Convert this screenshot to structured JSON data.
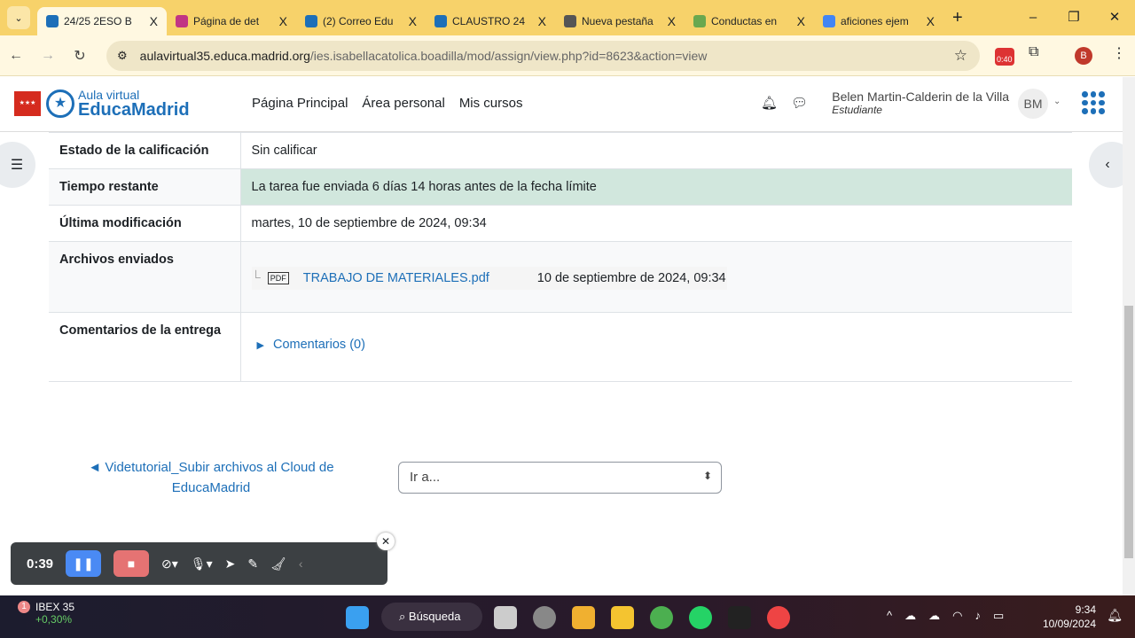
{
  "browser": {
    "tabs": [
      {
        "title": "24/25 2ESO B",
        "color": "#1d6fb8"
      },
      {
        "title": "Página de det",
        "color": "#c13584"
      },
      {
        "title": "(2) Correo Edu",
        "color": "#1d6fb8"
      },
      {
        "title": "CLAUSTRO 24",
        "color": "#1d6fb8"
      },
      {
        "title": "Nueva pestaña",
        "color": "#555555"
      },
      {
        "title": "Conductas en",
        "color": "#6aa84f"
      },
      {
        "title": "aficiones ejem",
        "color": "#4285f4"
      }
    ],
    "close": "X",
    "new_tab": "+",
    "url_host": "aulavirtual35.educa.madrid.org",
    "url_path": "/ies.isabellacatolica.boadilla/mod/assign/view.php?id=8623&action=view",
    "ext_badge": "0:40",
    "profile": "B"
  },
  "header": {
    "logo_top": "Aula virtual",
    "logo_bottom": "EducaMadrid",
    "menu": [
      "Página Principal",
      "Área personal",
      "Mis cursos"
    ],
    "user_name": "Belen Martin-Calderin de la Villa",
    "user_role": "Estudiante",
    "initials": "BM"
  },
  "status": {
    "rows": [
      {
        "label": "Estado de la calificación",
        "value": "Sin calificar"
      },
      {
        "label": "Tiempo restante",
        "value": "La tarea fue enviada 6 días 14 horas antes de la fecha límite"
      },
      {
        "label": "Última modificación",
        "value": "martes, 10 de septiembre de 2024, 09:34"
      },
      {
        "label": "Archivos enviados",
        "file": "TRABAJO DE MATERIALES.pdf",
        "file_date": "10 de septiembre de 2024, 09:34"
      },
      {
        "label": "Comentarios de la entrega",
        "comments": "Comentarios (0)"
      }
    ]
  },
  "nav": {
    "prev": "◄ Videtutorial_Subir archivos al Cloud de EducaMadrid",
    "jump": "Ir a..."
  },
  "recorder": {
    "time": "0:39"
  },
  "taskbar": {
    "badge": "1",
    "stock": "IBEX 35",
    "change": "+0,30%",
    "search": "Búsqueda",
    "time": "9:34",
    "date": "10/09/2024"
  }
}
